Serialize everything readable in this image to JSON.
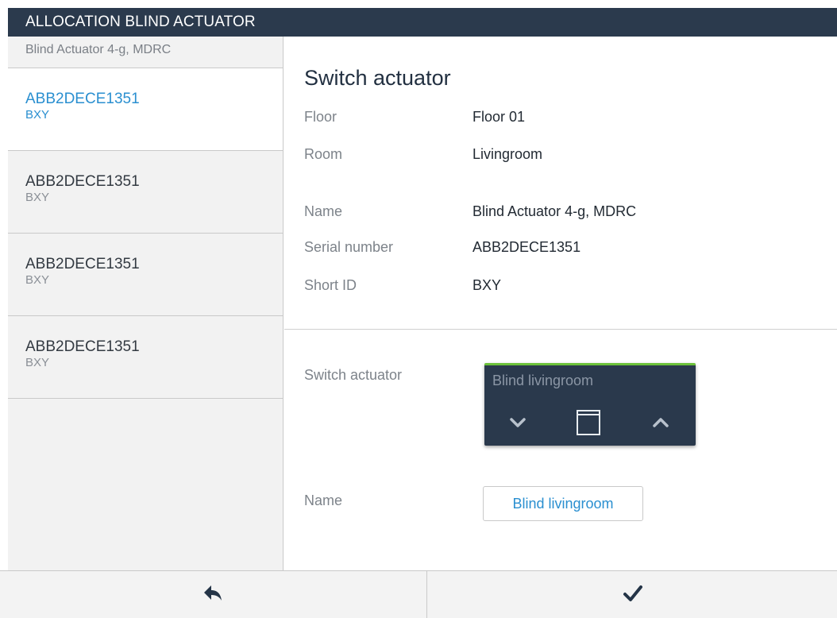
{
  "header": {
    "title": "ALLOCATION BLIND ACTUATOR"
  },
  "sidebar": {
    "header": "Blind Actuator 4-g, MDRC",
    "devices": [
      {
        "serial": "ABB2DECE1351",
        "short_id": "BXY",
        "selected": true
      },
      {
        "serial": "ABB2DECE1351",
        "short_id": "BXY",
        "selected": false
      },
      {
        "serial": "ABB2DECE1351",
        "short_id": "BXY",
        "selected": false
      },
      {
        "serial": "ABB2DECE1351",
        "short_id": "BXY",
        "selected": false
      }
    ]
  },
  "details": {
    "title": "Switch actuator",
    "floor_label": "Floor",
    "floor_value": "Floor 01",
    "room_label": "Room",
    "room_value": "Livingroom",
    "name_label": "Name",
    "name_value": "Blind Actuator 4-g, MDRC",
    "serial_label": "Serial number",
    "serial_value": "ABB2DECE1351",
    "short_label": "Short ID",
    "short_value": "BXY"
  },
  "actuator": {
    "label": "Switch actuator",
    "tile_title": "Blind livingroom",
    "down_icon": "chevron-down-icon",
    "stop_icon": "window-square-icon",
    "up_icon": "chevron-up-icon"
  },
  "name_field": {
    "label": "Name",
    "value": "Blind livingroom"
  },
  "footer": {
    "back_icon": "reply-arrow-icon",
    "confirm_icon": "checkmark-icon"
  },
  "colors": {
    "titlebar": "#2b3a4d",
    "accent_blue": "#2a8fd0",
    "tile_bg": "#2a394c",
    "tile_status": "#6cc13a"
  }
}
